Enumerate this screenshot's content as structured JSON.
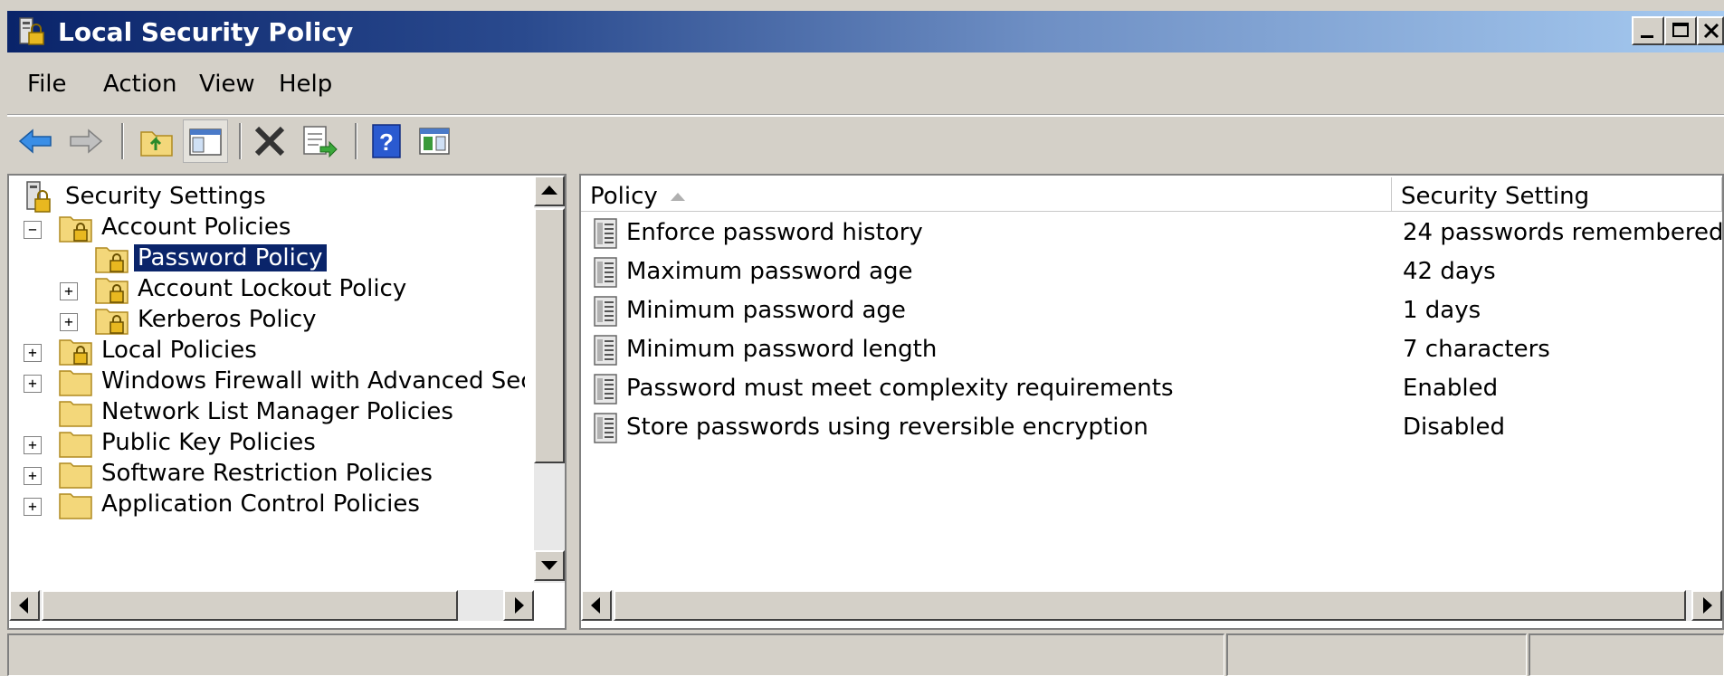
{
  "window": {
    "title": "Local Security Policy",
    "controls": {
      "minimize": "_",
      "maximize": "□",
      "close": "✕"
    }
  },
  "menu": {
    "items": [
      "File",
      "Action",
      "View",
      "Help"
    ]
  },
  "toolbar": {
    "buttons": [
      "back-icon",
      "forward-icon",
      "up-folder-icon",
      "show-hide-tree-icon",
      "delete-icon",
      "export-list-icon",
      "help-icon",
      "action-pane-icon"
    ]
  },
  "tree": {
    "items": [
      {
        "label": "Security Settings",
        "expander": "",
        "icon": "security-settings-icon"
      },
      {
        "label": "Account Policies",
        "expander": "−",
        "icon": "locked-folder-icon"
      },
      {
        "label": "Password Policy",
        "expander": "",
        "icon": "locked-folder-icon",
        "selected": true
      },
      {
        "label": "Account Lockout Policy",
        "expander": "+",
        "icon": "locked-folder-icon"
      },
      {
        "label": "Kerberos Policy",
        "expander": "+",
        "icon": "locked-folder-icon"
      },
      {
        "label": "Local Policies",
        "expander": "+",
        "icon": "locked-folder-icon"
      },
      {
        "label": "Windows Firewall with Advanced Secu",
        "expander": "+",
        "icon": "folder-icon"
      },
      {
        "label": "Network List Manager Policies",
        "expander": "",
        "icon": "folder-icon"
      },
      {
        "label": "Public Key Policies",
        "expander": "+",
        "icon": "folder-icon"
      },
      {
        "label": "Software Restriction Policies",
        "expander": "+",
        "icon": "folder-icon"
      },
      {
        "label": "Application Control Policies",
        "expander": "+",
        "icon": "folder-icon"
      }
    ]
  },
  "list": {
    "columns": {
      "policy": "Policy",
      "setting": "Security Setting"
    },
    "rows": [
      {
        "policy": "Enforce password history",
        "setting": "24 passwords remembered"
      },
      {
        "policy": "Maximum password age",
        "setting": "42 days"
      },
      {
        "policy": "Minimum password age",
        "setting": "1 days"
      },
      {
        "policy": "Minimum password length",
        "setting": "7 characters"
      },
      {
        "policy": "Password must meet complexity requirements",
        "setting": "Enabled"
      },
      {
        "policy": "Store passwords using reversible encryption",
        "setting": "Disabled"
      }
    ]
  },
  "colors": {
    "titlebar_start": "#0a246a",
    "titlebar_end": "#a6caf0",
    "selection": "#0a246a",
    "chrome": "#d4d0c8",
    "folder": "#f3d77a"
  }
}
